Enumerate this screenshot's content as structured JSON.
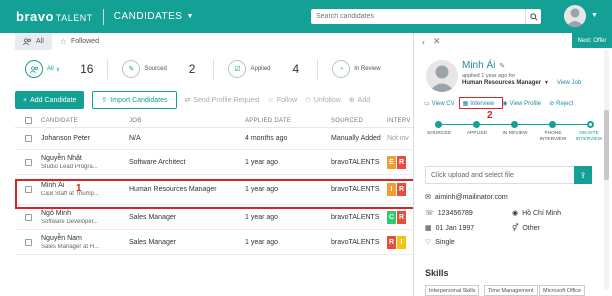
{
  "header": {
    "logo_bold": "bravo",
    "logo_rest": "TALENT",
    "section": "CANDIDATES",
    "search_placeholder": "Search candidates"
  },
  "tabs": [
    {
      "label": "All",
      "icon": "users-icon",
      "active": true
    },
    {
      "label": "Followed",
      "icon": "star-icon",
      "active": false
    }
  ],
  "stats": {
    "all": {
      "label": "All",
      "count": "16"
    },
    "sourced": {
      "label": "Sourced",
      "count": "2"
    },
    "applied": {
      "label": "Applied",
      "count": "4"
    },
    "inreview": {
      "label": "In Review"
    }
  },
  "actions": {
    "add": "Add Candidate",
    "import": "Import Candidates",
    "send": "Send Profile Request",
    "follow": "Follow",
    "unfollow": "Unfollow",
    "add_to": "Add"
  },
  "table": {
    "headers": [
      "CANDIDATE",
      "JOB",
      "APPLIED DATE",
      "SOURCED",
      "INTERV"
    ],
    "rows": [
      {
        "name": "Johanson Peter",
        "sub": "",
        "job": "N/A",
        "date": "4 months ago",
        "source": "Manually Added",
        "interview": "Not inv"
      },
      {
        "name": "Nguyễn Nhật",
        "sub": "Studio Lead Progra...",
        "job": "Software Architect",
        "date": "1 year ago",
        "source": "bravoTALENTS",
        "score": [
          "E",
          "R"
        ]
      },
      {
        "name": "Minh Ái",
        "sub": "C&B Staff at Triump...",
        "job": "Human Resources Manager",
        "date": "1 year ago",
        "source": "bravoTALENTS",
        "score": [
          "I",
          "R"
        ]
      },
      {
        "name": "Ngô Minh",
        "sub": "Software Developer...",
        "job": "Sales Manager",
        "date": "1 year ago",
        "source": "bravoTALENTS",
        "score": [
          "C",
          "R"
        ]
      },
      {
        "name": "Nguyễn Nam",
        "sub": "Sales Manager at H...",
        "job": "Sales Manager",
        "date": "1 year ago",
        "source": "bravoTALENTS",
        "score": [
          "R",
          "I"
        ]
      }
    ]
  },
  "annotations": {
    "one": "1",
    "two": "2"
  },
  "panel": {
    "next_offer": "Next: Offer",
    "name": "Minh Ái",
    "applied": "applied 1 year ago for",
    "job": "Human Resources Manager",
    "view_job": "View Job",
    "links": [
      "View CV",
      "Interview",
      "View Profile",
      "Reject"
    ],
    "pipeline": [
      {
        "label": "SOURCED",
        "done": true
      },
      {
        "label": "APPLIED",
        "done": true
      },
      {
        "label": "IN REVIEW",
        "done": true
      },
      {
        "label": "PHONE INTERVIEW",
        "done": true
      },
      {
        "label": "ON-SITE INTERVIEW",
        "done": false,
        "active": true
      }
    ],
    "upload_placeholder": "Click upload and select file",
    "email": "aiminh@mailinator.com",
    "phone": "123456789",
    "city": "Hồ Chí Minh",
    "dob": "01 Jan 1997",
    "gender": "Other",
    "marital": "Single",
    "skills_title": "Skills",
    "skills": [
      "Interpersonal Skills",
      "Time Management",
      "Microsoft Office"
    ]
  },
  "colors": {
    "brand": "#14a095",
    "link": "#1e8aa8",
    "highlight": "#d9242a",
    "score_orange": "#f39c32",
    "score_red": "#e74c3c",
    "score_green": "#2ecc71",
    "score_yellow": "#f1c40f"
  }
}
